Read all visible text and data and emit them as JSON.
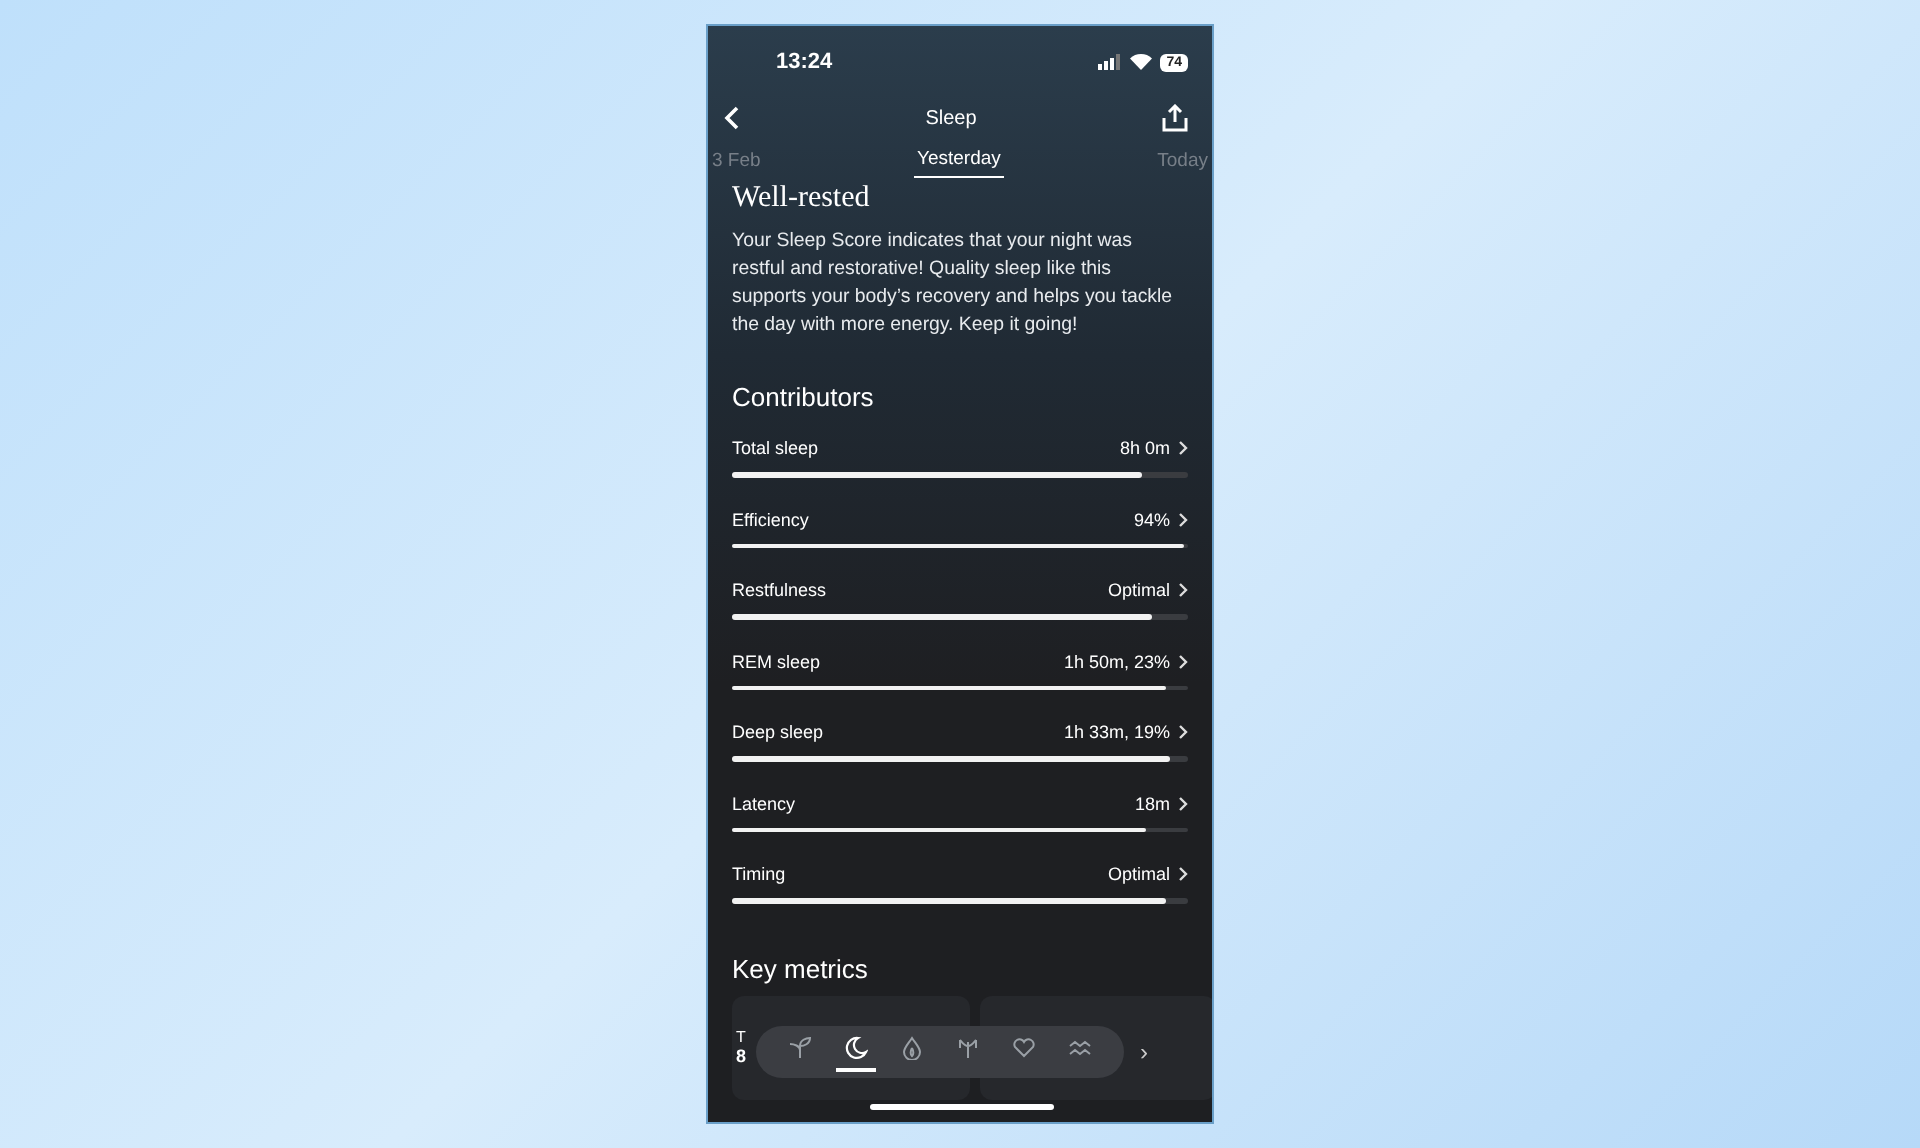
{
  "status_bar": {
    "time": "13:24",
    "battery": "74"
  },
  "header": {
    "title": "Sleep"
  },
  "date_tabs": [
    {
      "label": "3 Feb",
      "selected": false
    },
    {
      "label": "Yesterday",
      "selected": true
    },
    {
      "label": "Today",
      "selected": false
    }
  ],
  "summary": {
    "title": "Well-rested",
    "text": "Your Sleep Score indicates that your night was restful and restorative! Quality sleep like this supports your body’s recovery and helps you tackle the day with more energy. Keep it going!"
  },
  "contributors": {
    "heading": "Contributors",
    "items": [
      {
        "name": "Total sleep",
        "value": "8h 0m",
        "level": 0.9
      },
      {
        "name": "Efficiency",
        "value": "94%",
        "level": 0.99
      },
      {
        "name": "Restfulness",
        "value": "Optimal",
        "level": 0.92
      },
      {
        "name": "REM sleep",
        "value": "1h 50m, 23%",
        "level": 0.95
      },
      {
        "name": "Deep sleep",
        "value": "1h 33m, 19%",
        "level": 0.96
      },
      {
        "name": "Latency",
        "value": "18m",
        "level": 0.91
      },
      {
        "name": "Timing",
        "value": "Optimal",
        "level": 0.95
      }
    ]
  },
  "key_metrics": {
    "heading": "Key metrics",
    "cards": [
      {
        "label": "T",
        "value": "8"
      }
    ]
  },
  "tab_bar": {
    "items": [
      {
        "kind": "sprout",
        "selected": false
      },
      {
        "kind": "moon",
        "selected": true
      },
      {
        "kind": "flame",
        "selected": false
      },
      {
        "kind": "figure",
        "selected": false
      },
      {
        "kind": "heart",
        "selected": false
      },
      {
        "kind": "waves",
        "selected": false
      }
    ],
    "more": "›"
  }
}
